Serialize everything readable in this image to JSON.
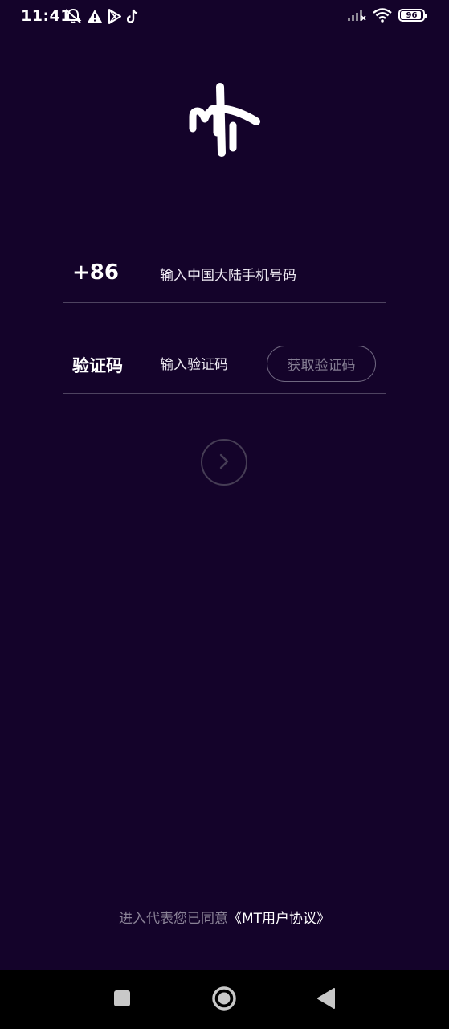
{
  "status_bar": {
    "time": "11:41",
    "battery_level": "96",
    "icons": [
      "mute-bell-icon",
      "warning-icon",
      "play-store-icon",
      "tiktok-icon",
      "signal-icon",
      "wifi-icon",
      "battery-icon"
    ]
  },
  "logo": {
    "icon": "mt-logo-icon"
  },
  "login_form": {
    "phone": {
      "prefix": "+86",
      "placeholder": "输入中国大陆手机号码",
      "value": ""
    },
    "code": {
      "label": "验证码",
      "placeholder": "输入验证码",
      "value": "",
      "get_code_label": "获取验证码"
    },
    "next_icon": "chevron-right-icon"
  },
  "agreement": {
    "prefix": "进入代表您已同意",
    "link": "《MT用户协议》"
  },
  "nav_bar": {
    "icons": [
      "recents-icon",
      "home-icon",
      "back-icon"
    ]
  },
  "colors": {
    "background": "#14032a",
    "divider": "#4e4360",
    "muted_text": "#8a8296",
    "nav_bar": "#000000"
  }
}
